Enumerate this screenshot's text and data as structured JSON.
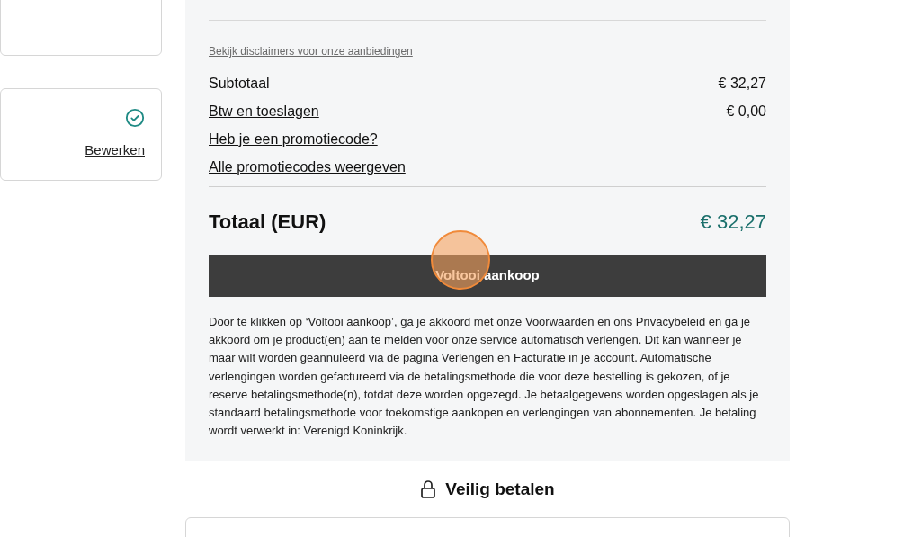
{
  "side_cards": [
    {
      "complete": false
    },
    {
      "complete": true,
      "edit_link": "Bewerken"
    }
  ],
  "summary": {
    "disclaimer_link": "Bekijk disclaimers voor onze aanbiedingen",
    "lines": [
      {
        "label": "Subtotaal",
        "value": "€ 32,27",
        "kind": "text"
      },
      {
        "label": "Btw en toeslagen",
        "value": "€ 0,00",
        "kind": "link"
      },
      {
        "label": "Heb je een promotiecode?",
        "kind": "link"
      },
      {
        "label": "Alle promotiecodes weergeven",
        "kind": "link"
      }
    ],
    "total_label": "Totaal (EUR)",
    "total_value": "€ 32,27",
    "button": "Voltooi aankoop",
    "terms": [
      {
        "kind": "text",
        "text": "Door te klikken op ‘Voltooi aankoop’, ga je akkoord met onze "
      },
      {
        "kind": "link",
        "text": "Voorwaarden"
      },
      {
        "kind": "text",
        "text": " en ons "
      },
      {
        "kind": "link",
        "text": "Privacybeleid"
      },
      {
        "kind": "text",
        "text": " en ga je akkoord om je product(en) aan te melden voor onze service automatisch verlengen. Dit kan wanneer je maar wilt worden geannuleerd via de pagina Verlengen en Facturatie in je account. Automatische verlengingen worden gefactureerd via de betalingsmethode die voor deze bestelling is gekozen, of je reserve betalingsmethode(n), totdat deze worden opgezegd. Je betaalgegevens worden opgeslagen als je standaard betalingsmethode voor toekomstige aankopen en verlengingen van abonnementen. Je betaling wordt verwerkt in: Verenigd Koninkrijk."
      }
    ]
  },
  "secure": {
    "title": "Veilig betalen"
  },
  "click_indicator": {
    "visible": true
  }
}
